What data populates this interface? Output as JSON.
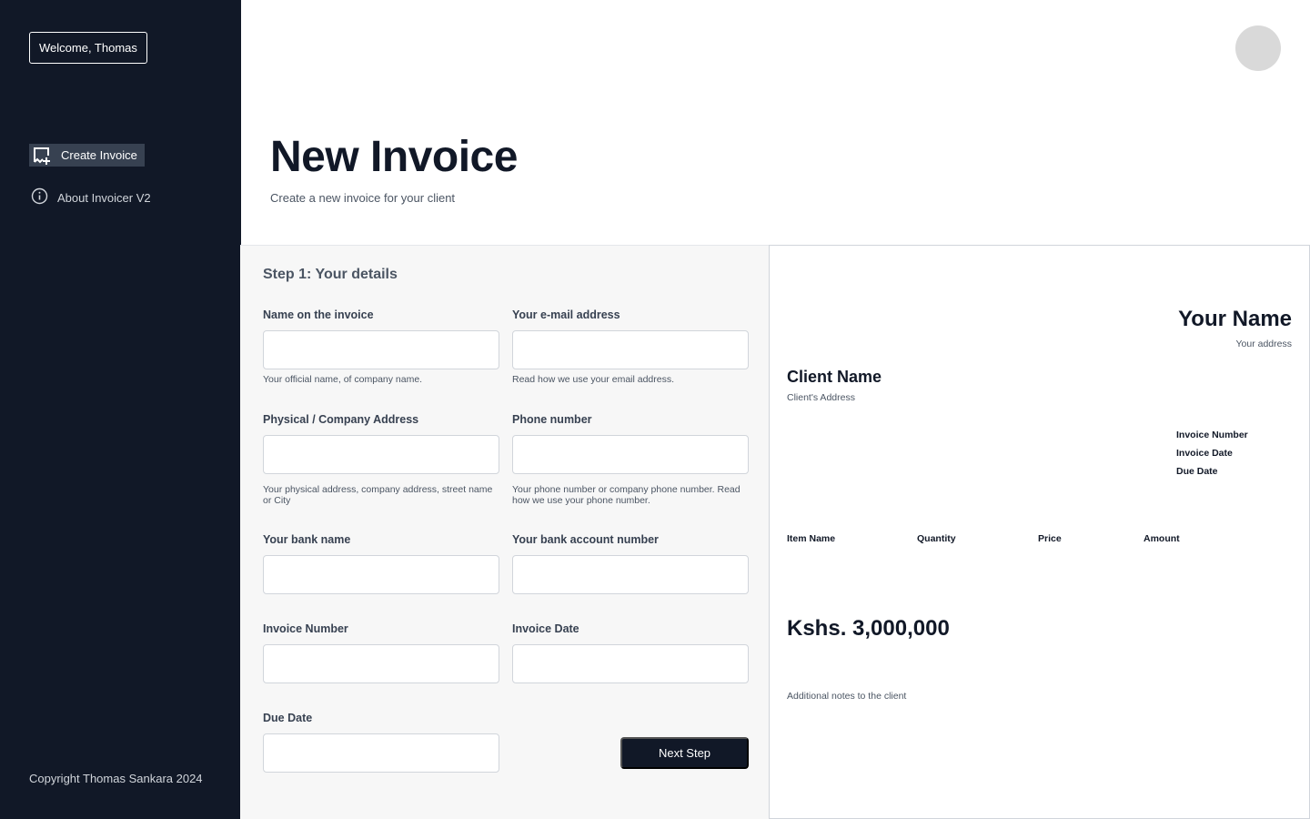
{
  "sidebar": {
    "welcome": "Welcome, Thomas",
    "nav": [
      {
        "label": "Create Invoice",
        "icon": "create-invoice-icon"
      },
      {
        "label": "About Invoicer V2",
        "icon": "info-icon"
      }
    ],
    "copyright": "Copyright Thomas Sankara 2024"
  },
  "header": {
    "title": "New Invoice",
    "subtitle": "Create a new invoice for your client"
  },
  "form": {
    "step_title": "Step 1: Your details",
    "fields": [
      {
        "label": "Name on the invoice",
        "value": "",
        "help": "Your official name, of company name."
      },
      {
        "label": "Your e-mail address",
        "value": "",
        "help": "Read how we use your email address."
      },
      {
        "label": "Physical / Company Address",
        "value": "",
        "help": "Your physical address, company address, street name or City"
      },
      {
        "label": "Phone number",
        "value": "",
        "help": "Your phone number or company phone number. Read how we use your phone number."
      },
      {
        "label": "Your bank name",
        "value": ""
      },
      {
        "label": "Your bank account number",
        "value": ""
      },
      {
        "label": "Invoice Number",
        "value": ""
      },
      {
        "label": "Invoice Date",
        "value": ""
      },
      {
        "label": "Due Date",
        "value": ""
      }
    ],
    "next_button": "Next Step"
  },
  "preview": {
    "your_name": "Your Name",
    "your_address": "Your address",
    "client_name": "Client Name",
    "client_address": "Client's Address",
    "meta": [
      "Invoice Number",
      "Invoice Date",
      "Due Date"
    ],
    "columns": [
      "Item Name",
      "Quantity",
      "Price",
      "Amount"
    ],
    "total": "Kshs. 3,000,000",
    "notes": "Additional notes to the client"
  },
  "colors": {
    "sidebar_bg": "#111827",
    "nav_active_bg": "#374151",
    "form_bg": "#f7f7f7",
    "primary_button": "#111827",
    "avatar": "#d9d9d9"
  }
}
